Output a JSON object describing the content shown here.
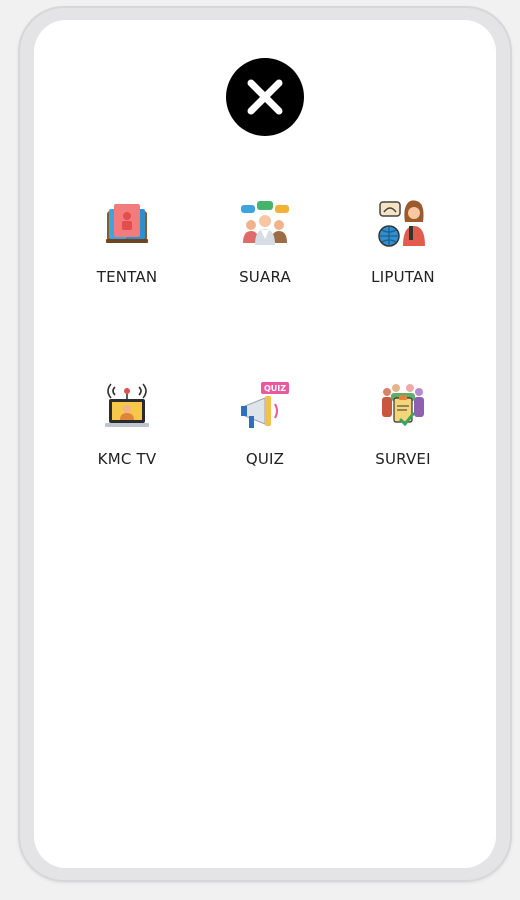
{
  "menu": {
    "close_icon": "close-icon",
    "items": [
      {
        "label": "TENTAN",
        "icon": "book-icon"
      },
      {
        "label": "SUARA",
        "icon": "people-chat-icon"
      },
      {
        "label": "LIPUTAN",
        "icon": "reporter-globe-icon"
      },
      {
        "label": "KMC TV",
        "icon": "broadcast-laptop-icon"
      },
      {
        "label": "QUIZ",
        "icon": "megaphone-quiz-icon"
      },
      {
        "label": "SURVEI",
        "icon": "survey-crowd-icon"
      }
    ],
    "quiz_badge": "QUIZ"
  },
  "colors": {
    "close_bg": "#000000",
    "close_x": "#ffffff",
    "label_text": "#222222"
  }
}
